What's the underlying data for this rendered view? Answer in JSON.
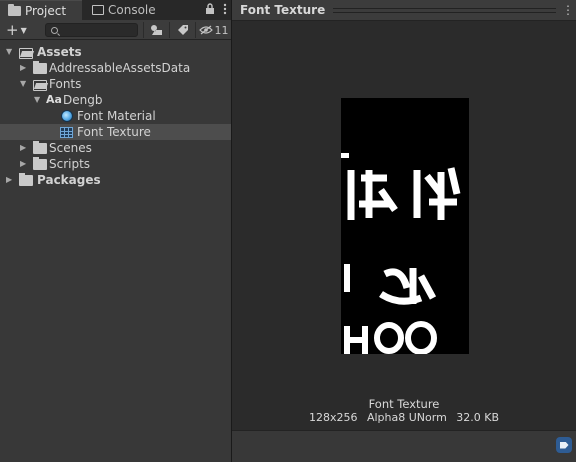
{
  "left_tabs": {
    "project_label": "Project",
    "console_label": "Console"
  },
  "toolbar": {
    "create_label": "+",
    "search_value": "",
    "search_placeholder": "",
    "hidden_count": "11"
  },
  "tree": [
    {
      "label": "Assets",
      "bold": true,
      "icon": "folder-open-icon",
      "expanded": true
    },
    {
      "label": "AddressableAssetsData",
      "icon": "folder-icon",
      "expanded": false
    },
    {
      "label": "Fonts",
      "icon": "folder-open-icon",
      "expanded": true
    },
    {
      "label": "Dengb",
      "icon": "font-icon",
      "icon_text": "Aa",
      "expanded": true
    },
    {
      "label": "Font Material",
      "icon": "material-icon"
    },
    {
      "label": "Font Texture",
      "icon": "texture-icon",
      "selected": true
    },
    {
      "label": "Scenes",
      "icon": "folder-icon",
      "expanded": false
    },
    {
      "label": "Scripts",
      "icon": "folder-icon",
      "expanded": false
    },
    {
      "label": "Packages",
      "bold": true,
      "icon": "folder-icon",
      "expanded": false
    }
  ],
  "preview": {
    "title": "Font Texture",
    "asset_name": "Font Texture",
    "dimensions": "128x256",
    "format": "Alpha8 UNorm",
    "size": "32.0 KB"
  },
  "colors": {
    "panel_bg": "#383838",
    "selection": "#4d4d4d",
    "preview_bg": "#2b2b2b",
    "label_button": "#2e5c94"
  }
}
